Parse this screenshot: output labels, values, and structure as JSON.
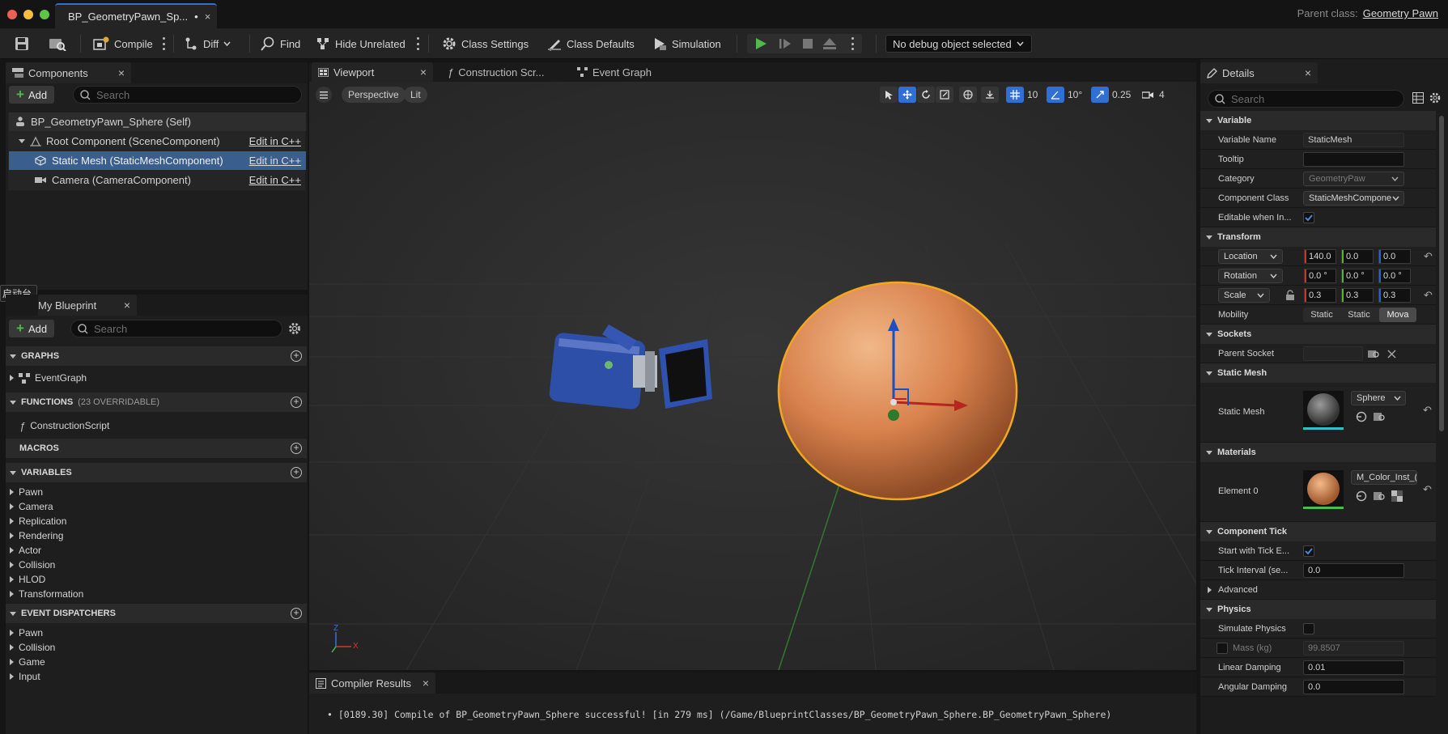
{
  "window": {
    "tab_title": "BP_GeometryPawn_Sp...",
    "modified_marker": "•",
    "parent_class_label": "Parent class:",
    "parent_class_value": "Geometry Pawn"
  },
  "toolbar": {
    "compile": "Compile",
    "diff": "Diff",
    "find": "Find",
    "hide_unrelated": "Hide Unrelated",
    "class_settings": "Class Settings",
    "class_defaults": "Class Defaults",
    "simulation": "Simulation",
    "debug_object": "No debug object selected"
  },
  "components": {
    "tab": "Components",
    "add": "Add",
    "search_placeholder": "Search",
    "items": [
      {
        "label": "BP_GeometryPawn_Sphere (Self)"
      },
      {
        "label": "Root Component (SceneComponent)",
        "edit": "Edit in C++"
      },
      {
        "label": "Static Mesh (StaticMeshComponent)",
        "edit": "Edit in C++"
      },
      {
        "label": "Camera (CameraComponent)",
        "edit": "Edit in C++"
      }
    ]
  },
  "overlay_tag": "启动台",
  "my_blueprint": {
    "tab": "My Blueprint",
    "add": "Add",
    "search_placeholder": "Search",
    "graphs_header": "GRAPHS",
    "graphs": [
      "EventGraph"
    ],
    "functions_header": "FUNCTIONS",
    "functions_note": "(23 OVERRIDABLE)",
    "functions": [
      "ConstructionScript"
    ],
    "macros_header": "MACROS",
    "variables_header": "VARIABLES",
    "variables": [
      "Pawn",
      "Camera",
      "Replication",
      "Rendering",
      "Actor",
      "Collision",
      "HLOD",
      "Transformation"
    ],
    "dispatchers_header": "EVENT DISPATCHERS",
    "dispatchers": [
      "Pawn",
      "Collision",
      "Game",
      "Input"
    ]
  },
  "editor_tabs": [
    "Viewport",
    "Construction Scr...",
    "Event Graph"
  ],
  "viewport": {
    "perspective": "Perspective",
    "lit": "Lit",
    "grid_snap": "10",
    "rot_snap": "10°",
    "scale_snap": "0.25",
    "cam_speed": "4",
    "axis_x": "X",
    "axis_z": "Z"
  },
  "details": {
    "tab": "Details",
    "search_placeholder": "Search",
    "variable_header": "Variable",
    "variable_name_label": "Variable Name",
    "variable_name": "StaticMesh",
    "tooltip_label": "Tooltip",
    "tooltip": "",
    "category_label": "Category",
    "category": "GeometryPaw",
    "component_class_label": "Component Class",
    "component_class": "StaticMeshCompone",
    "editable_label": "Editable when In...",
    "transform_header": "Transform",
    "location_label": "Location",
    "location": [
      "140.0",
      "0.0",
      "0.0"
    ],
    "rotation_label": "Rotation",
    "rotation": [
      "0.0 °",
      "0.0 °",
      "0.0 °"
    ],
    "scale_label": "Scale",
    "scale": [
      "0.3",
      "0.3",
      "0.3"
    ],
    "mobility_label": "Mobility",
    "mobility_options": [
      "Static",
      "Static",
      "Mova"
    ],
    "sockets_header": "Sockets",
    "parent_socket_label": "Parent Socket",
    "static_mesh_header": "Static Mesh",
    "static_mesh_label": "Static Mesh",
    "static_mesh_value": "Sphere",
    "materials_header": "Materials",
    "element0_label": "Element 0",
    "element0_value": "M_Color_Inst_(",
    "tick_header": "Component Tick",
    "start_tick_label": "Start with Tick E...",
    "tick_interval_label": "Tick Interval (se...",
    "tick_interval": "0.0",
    "advanced": "Advanced",
    "physics_header": "Physics",
    "simulate_label": "Simulate Physics",
    "mass_label": "Mass (kg)",
    "mass": "99.8507",
    "linear_label": "Linear Damping",
    "linear": "0.01",
    "angular_label": "Angular Damping",
    "angular": "0.0"
  },
  "compiler": {
    "tab": "Compiler Results",
    "message": "• [0189.30] Compile of BP_GeometryPawn_Sphere successful! [in 279 ms] (/Game/BlueprintClasses/BP_GeometryPawn_Sphere.BP_GeometryPawn_Sphere)"
  },
  "colors": {
    "accent": "#2f6fd6",
    "play": "#4fb84f",
    "selection": "#3a5f8f",
    "sphere": "#d9824d",
    "outline": "#f2a81d"
  }
}
